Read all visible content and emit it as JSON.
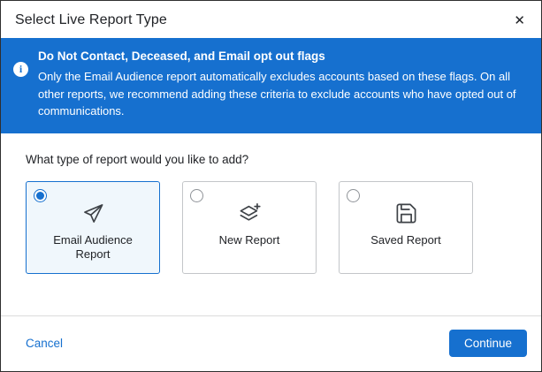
{
  "dialog": {
    "title": "Select Live Report Type"
  },
  "banner": {
    "heading": "Do Not Contact, Deceased, and Email opt out flags",
    "body": "Only the Email Audience report automatically excludes accounts based on these flags. On all other reports, we recommend adding these criteria to exclude accounts who have opted out of communications.",
    "info_icon_glyph": "i"
  },
  "question": "What type of report would you like to add?",
  "options": [
    {
      "label": "Email Audience Report",
      "icon": "paper-plane-icon",
      "selected": true
    },
    {
      "label": "New Report",
      "icon": "layers-plus-icon",
      "selected": false
    },
    {
      "label": "Saved Report",
      "icon": "save-icon",
      "selected": false
    }
  ],
  "footer": {
    "cancel_label": "Cancel",
    "continue_label": "Continue"
  },
  "colors": {
    "accent": "#1670cf",
    "banner_bg": "#1670cf",
    "selected_card_bg": "#f0f7fc",
    "selected_card_border": "#1670cf"
  },
  "icons": {
    "close": "x-icon",
    "info": "info-circle-icon"
  }
}
